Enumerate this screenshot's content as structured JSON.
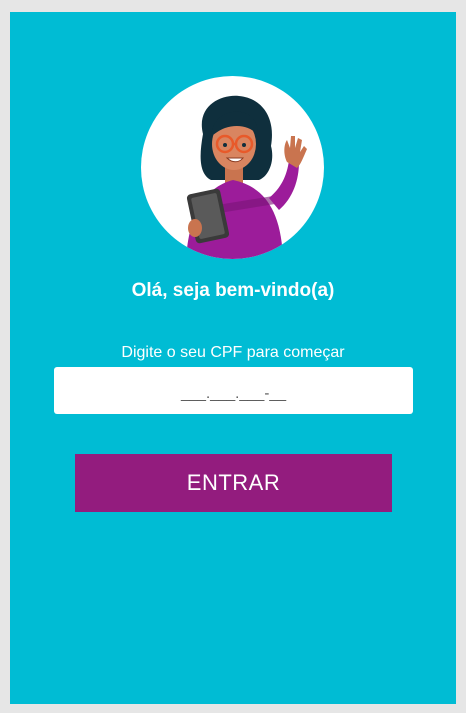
{
  "welcome": {
    "greeting": "Olá, seja bem-vindo(a)",
    "prompt": "Digite o seu CPF para começar",
    "avatar_icon": "woman-with-tablet-waving-illustration"
  },
  "cpf_field": {
    "placeholder": "___.___.___-__",
    "value": ""
  },
  "actions": {
    "enter_label": "ENTRAR"
  },
  "colors": {
    "background": "#00bcd4",
    "button": "#931c7e",
    "text": "#ffffff"
  }
}
